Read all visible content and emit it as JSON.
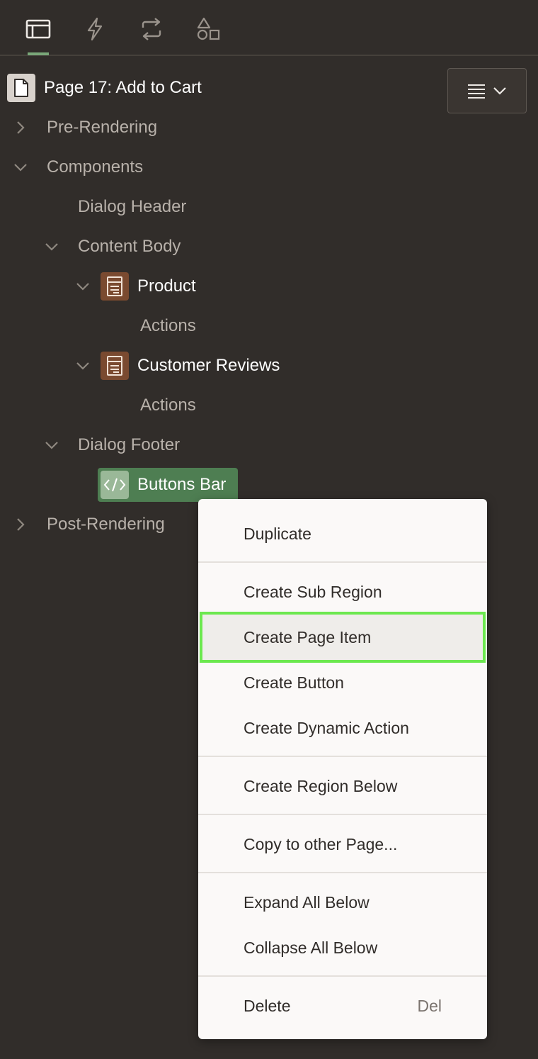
{
  "tabs": [
    {
      "icon": "rendering-tree-icon",
      "active": true
    },
    {
      "icon": "dynamic-actions-lightning-icon",
      "active": false
    },
    {
      "icon": "processing-cycle-icon",
      "active": false
    },
    {
      "icon": "shared-components-shapes-icon",
      "active": false
    }
  ],
  "tree": {
    "page_title": "Page 17: Add to Cart",
    "pre_rendering": "Pre-Rendering",
    "components": "Components",
    "dialog_header": "Dialog Header",
    "content_body": "Content Body",
    "product": "Product",
    "product_actions": "Actions",
    "customer_reviews": "Customer Reviews",
    "reviews_actions": "Actions",
    "dialog_footer": "Dialog Footer",
    "buttons_bar": "Buttons Bar",
    "post_rendering": "Post-Rendering"
  },
  "context_menu": {
    "duplicate": "Duplicate",
    "create_sub_region": "Create Sub Region",
    "create_page_item": "Create Page Item",
    "create_button": "Create Button",
    "create_dynamic_action": "Create Dynamic Action",
    "create_region_below": "Create Region Below",
    "copy_to_other_page": "Copy to other Page...",
    "expand_all_below": "Expand All Below",
    "collapse_all_below": "Collapse All Below",
    "delete": "Delete",
    "delete_shortcut": "Del"
  },
  "colors": {
    "background": "#312d2a",
    "selected": "#4e7e52",
    "active_tab": "#7aa779",
    "menu_highlight_outline": "#6ce84f",
    "region_icon": "#7a4a30"
  }
}
